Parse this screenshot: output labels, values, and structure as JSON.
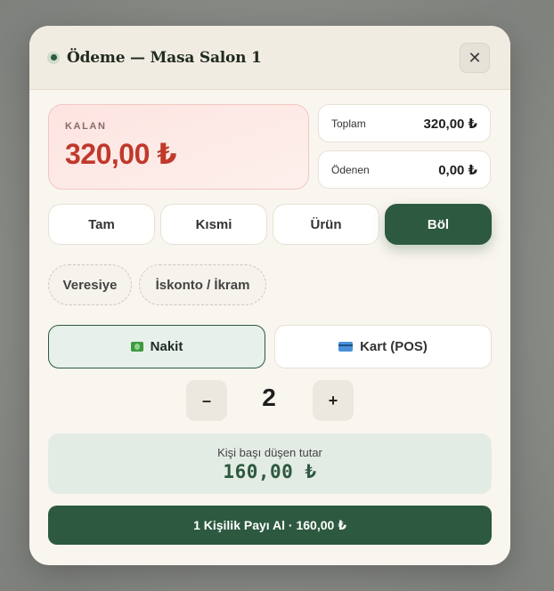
{
  "header": {
    "title": "Ödeme — Masa Salon 1",
    "close_label": "✕"
  },
  "summary": {
    "remaining_label": "KALAN",
    "remaining_value": "320,00 ₺",
    "total_label": "Toplam",
    "total_value": "320,00 ₺",
    "paid_label": "Ödenen",
    "paid_value": "0,00 ₺"
  },
  "modes": [
    {
      "label": "Tam"
    },
    {
      "label": "Kısmi"
    },
    {
      "label": "Ürün"
    },
    {
      "label": "Böl"
    }
  ],
  "extra_options": [
    {
      "label": "Veresiye"
    },
    {
      "label": "İskonto / İkram"
    }
  ],
  "payment_methods": [
    {
      "label": "Nakit",
      "icon": "cash-icon"
    },
    {
      "label": "Kart (POS)",
      "icon": "card-icon"
    }
  ],
  "split": {
    "minus_label": "–",
    "plus_label": "+",
    "count": "2",
    "per_person_label": "Kişi başı düşen tutar",
    "per_person_value": "160,00 ₺"
  },
  "submit_label": "1 Kişilik Payı Al · 160,00 ₺",
  "colors": {
    "accent": "#2d5940",
    "danger": "#c0392b",
    "background": "#f9f6ef"
  }
}
